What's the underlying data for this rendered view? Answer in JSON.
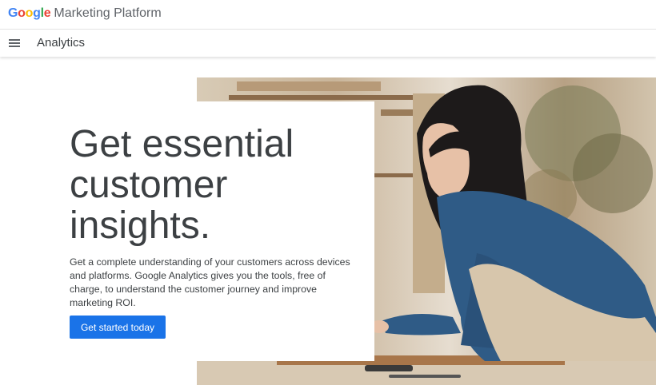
{
  "header": {
    "brand_google": "Google",
    "brand_platform": "Marketing Platform",
    "google_colors": [
      "#4285F4",
      "#EA4335",
      "#FBBC05",
      "#4285F4",
      "#34A853",
      "#EA4335"
    ]
  },
  "subnav": {
    "menu_icon": "hamburger-menu-icon",
    "product": "Analytics"
  },
  "hero": {
    "headline": "Get essential customer insights.",
    "description": "Get a complete understanding of your customers across devices and platforms. Google Analytics gives you the tools, free of charge, to understand the customer journey and improve marketing ROI.",
    "cta_label": "Get started today",
    "accent": "#1a73e8"
  }
}
